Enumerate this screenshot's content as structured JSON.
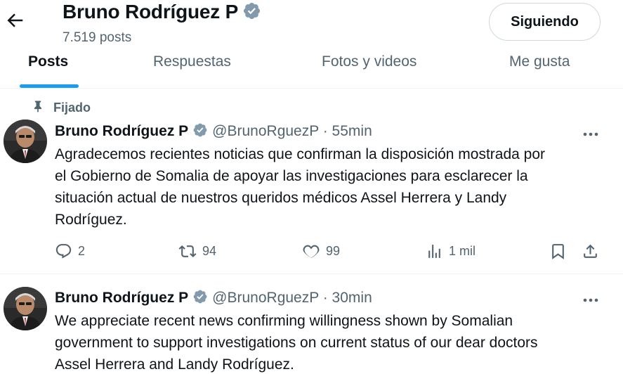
{
  "header": {
    "name": "Bruno Rodríguez P",
    "posts_count": "7.519 posts",
    "follow_label": "Siguiendo"
  },
  "tabs": [
    {
      "label": "Posts",
      "active": true
    },
    {
      "label": "Respuestas",
      "active": false
    },
    {
      "label": "Fotos y videos",
      "active": false
    },
    {
      "label": "Me gusta",
      "active": false
    }
  ],
  "colors": {
    "accent": "#1d9bf0",
    "verified_badge": "#829aab",
    "secondary_text": "#536471"
  },
  "tweets": [
    {
      "pinned_label": "Fijado",
      "author": "Bruno Rodríguez P",
      "handle": "@BrunoRguezP",
      "separator": "·",
      "time": "55min",
      "text_lines": [
        "Agradecemos recientes noticias que confirman la disposición mostrada por",
        "el Gobierno de Somalia de apoyar las investigaciones para esclarecer la",
        "situación actual de nuestros queridos médicos Assel Herrera y Landy",
        "Rodríguez."
      ],
      "replies": "2",
      "reposts": "94",
      "likes": "99",
      "views": "1 mil"
    },
    {
      "author": "Bruno Rodríguez P",
      "handle": "@BrunoRguezP",
      "separator": "·",
      "time": "30min",
      "text_lines": [
        "We appreciate recent news confirming willingness shown by Somalian",
        "government to support investigations on current status of our dear doctors",
        "Assel Herrera and Landy Rodríguez."
      ]
    }
  ],
  "icons": [
    "back-arrow-icon",
    "verified-badge-icon",
    "pin-icon",
    "more-icon",
    "reply-icon",
    "repost-icon",
    "like-icon",
    "views-icon",
    "bookmark-icon",
    "share-icon"
  ]
}
